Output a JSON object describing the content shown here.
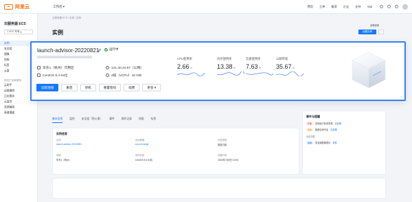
{
  "topbar": {
    "brand": "阿里云",
    "workspace": "工作台",
    "links": [
      "费用",
      "工单",
      "备案",
      "企业",
      "支持",
      "App"
    ]
  },
  "sidebar": {
    "title": "云服务器 ECS",
    "select_value": "1 VPC 专有",
    "items": [
      {
        "label": "实例",
        "active": true
      },
      {
        "label": "安全组",
        "active": false
      },
      {
        "label": "镜像",
        "active": false
      },
      {
        "label": "快照",
        "active": false
      },
      {
        "label": "标签",
        "active": false
      },
      {
        "label": "云盘",
        "active": false
      }
    ],
    "section": "相关产品和服务",
    "sub_items": [
      "云助手",
      "运维编排",
      "日志服务",
      "云监控",
      "资源编排",
      "高速通道"
    ]
  },
  "main": {
    "breadcrumb": "云服务器 ECS  /  实例  /  实例",
    "title": "实例",
    "helper_link": "远程连接",
    "create_button": "创建实例",
    "more_button": "···"
  },
  "instance": {
    "name": "launch-advisor-20220821",
    "status": "运行中",
    "region": "华东1（杭州）可用区",
    "ip": "121.40.24.97（公网）",
    "os": "CentOS 8.4 64位",
    "spec": "4核（vCPU）16 GiB",
    "actions": [
      "远程连接",
      "重启",
      "停机",
      "重置密码",
      "续费",
      "更多"
    ],
    "metrics": [
      {
        "label": "CPU使用率",
        "value": "2.66",
        "unit": "%"
      },
      {
        "label": "内存使用率",
        "value": "13.38",
        "unit": "%"
      },
      {
        "label": "云盘使用率",
        "value": "7.63",
        "unit": "%"
      },
      {
        "label": "公网带宽",
        "value": "35.67",
        "unit": "%"
      }
    ]
  },
  "details": {
    "tabs": [
      "基本信息",
      "监控",
      "安全组（防火墙）",
      "事件",
      "操作记录",
      "快照",
      "标签"
    ],
    "panel_title": "实例信息",
    "fields": [
      {
        "label": "名称",
        "value": "launch-advisor-20220821"
      },
      {
        "label": "实例规格",
        "value": "ecs.c6.xlarge"
      },
      {
        "label": "付费类型",
        "value": "按量付费"
      },
      {
        "label": "地域",
        "value": "华东1（杭州）"
      },
      {
        "label": "操作系统",
        "value": "CentOS 8.4 64位"
      },
      {
        "label": "创建时间",
        "value": "2024年7月5日 10:00"
      }
    ],
    "side_title": "事件与提醒",
    "side_rows": [
      {
        "tag": "严重",
        "color": "red",
        "text": "实例运行状态异常",
        "link": "去处理"
      },
      {
        "tag": "警告",
        "color": "orange",
        "text": "磁盘空间不足",
        "link": "去处理"
      },
      {
        "tag": "提醒",
        "color": "blue",
        "text": "安全组配置提示",
        "link": "查看"
      }
    ],
    "side_sub": "续费提醒"
  },
  "colors": {
    "accent": "#1677ff",
    "brand": "#ff6a00",
    "running": "#1aa251",
    "highlight_border": "#2f80ff"
  }
}
